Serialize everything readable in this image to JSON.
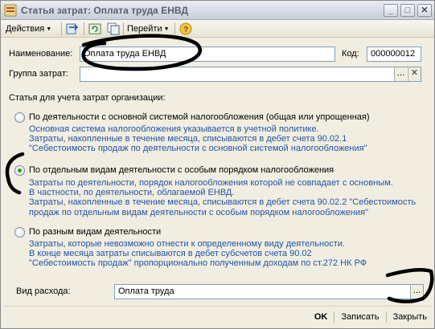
{
  "window": {
    "title": "Статья затрат: Оплата труда ЕНВД",
    "controls": {
      "minimize": "_",
      "maximize": "□",
      "close": "✕"
    }
  },
  "toolbar": {
    "actions": "Действия",
    "goto": "Перейти",
    "help": "?"
  },
  "form": {
    "name_label": "Наименование:",
    "name_value": "Оплата труда ЕНВД",
    "code_label": "Код:",
    "code_value": "000000012",
    "group_label": "Группа затрат:",
    "group_value": "",
    "group_select": "...",
    "group_clear": "✕",
    "section_label": "Статья для учета затрат организации:",
    "options": [
      {
        "label": "По деятельности с основной системой налогообложения (общая или упрощенная)",
        "checked": false,
        "desc": [
          "Основная система налогообложения указывается в учетной политике.",
          "Затраты, накопленные в течение месяца, списываются в дебет счета 90.02.1",
          "\"Себестоимость продаж по деятельности с основной системой налогообложения\""
        ]
      },
      {
        "label": "По отдельным видам деятельности с особым порядком налогообложения",
        "checked": true,
        "desc": [
          "Затраты по деятельности, порядок налогообложения которой не совпадает с основным.",
          "В частности, по деятельности, облагаемой ЕНВД.",
          "Затраты, накопленные в течение месяца, списываются в дебет счета 90.02.2 \"Себестоимость",
          "продаж по отдельным видам деятельности с особым порядком налогообложения\""
        ]
      },
      {
        "label": "По разным видам деятельности",
        "checked": false,
        "desc": [
          "Затраты, которые невозможно отнести к определенному виду деятельности.",
          "В конце месяца затраты списываются в дебет субсчетов счета 90.02",
          "\"Себестоимость продаж\" пропорционально полученным доходам по ст.272 НК РФ"
        ]
      }
    ],
    "expense_label": "Вид расхода:",
    "expense_value": "Оплата труда",
    "expense_select": "..."
  },
  "buttons": {
    "ok": "OK",
    "save": "Записать",
    "close": "Закрыть"
  },
  "colors": {
    "window_bg": "#f1ede0",
    "description_text": "#1f55a8",
    "radio_checked": "#21a121",
    "input_border": "#7f9db9"
  },
  "icons": [
    "app-icon",
    "dropdown-arrow-icon",
    "exchange-plan-icon",
    "refresh-icon",
    "copy-icon",
    "help-icon",
    "select-icon",
    "clear-icon",
    "radio-icon"
  ]
}
